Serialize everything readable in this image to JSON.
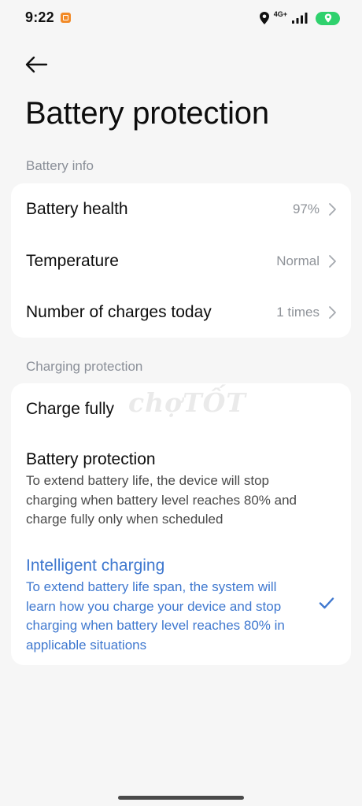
{
  "status_bar": {
    "time": "9:22",
    "app_icon": "store-icon",
    "network": "4G+",
    "icons": [
      "location-icon",
      "signal-icon",
      "battery-location-icon"
    ],
    "battery_color": "#2fd16d"
  },
  "nav": {
    "back_icon": "arrow-left-icon"
  },
  "page": {
    "title": "Battery protection"
  },
  "battery_info": {
    "header": "Battery info",
    "items": [
      {
        "label": "Battery health",
        "value": "97%"
      },
      {
        "label": "Temperature",
        "value": "Normal"
      },
      {
        "label": "Number of charges today",
        "value": "1 times"
      }
    ]
  },
  "charging_protection": {
    "header": "Charging protection",
    "options": [
      {
        "title": "Charge fully",
        "description": "",
        "selected": false
      },
      {
        "title": "Battery protection",
        "description": "To extend battery life, the device will stop charging when battery level reaches 80% and charge fully only when scheduled",
        "selected": false
      },
      {
        "title": "Intelligent charging",
        "description": "To extend battery life span, the system will learn how you charge your device and stop charging when battery level reaches 80% in applicable situations",
        "selected": true
      }
    ]
  },
  "watermark": "chợTỐT",
  "colors": {
    "accent": "#3f78cf",
    "background": "#f6f6f6",
    "card": "#ffffff",
    "secondary_text": "#8f9399"
  }
}
